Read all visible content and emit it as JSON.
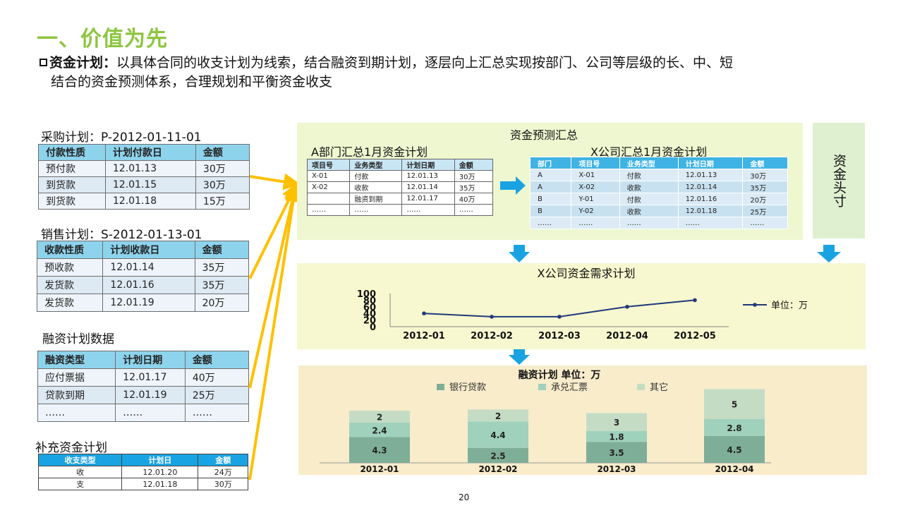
{
  "header": {
    "title": "一、价值为先",
    "bullet_lead": "资金计划：",
    "bullet_text1": "以具体合同的收支计划为线索，结合融资到期计划，逐层向上汇总实现按部门、公司等层级的长、中、短",
    "bullet_text2": "结合的资金预测体系，合理规划和平衡资金收支"
  },
  "purchase": {
    "label": "采购计划：P-2012-01-11-01",
    "headers": [
      "付款性质",
      "计划付款日",
      "金额"
    ],
    "rows": [
      [
        "预付款",
        "12.01.13",
        "30万"
      ],
      [
        "到货款",
        "12.01.15",
        "30万"
      ],
      [
        "到货款",
        "12.01.18",
        "15万"
      ]
    ]
  },
  "sales": {
    "label": "销售计划：S-2012-01-13-01",
    "headers": [
      "收款性质",
      "计划收款日",
      "金额"
    ],
    "rows": [
      [
        "预收款",
        "12.01.14",
        "35万"
      ],
      [
        "发货款",
        "12.01.16",
        "35万"
      ],
      [
        "发货款",
        "12.01.19",
        "20万"
      ]
    ]
  },
  "financing": {
    "label": "融资计划数据",
    "headers": [
      "融资类型",
      "计划日期",
      "金额"
    ],
    "rows": [
      [
        "应付票据",
        "12.01.17",
        "40万"
      ],
      [
        "贷款到期",
        "12.01.19",
        "25万"
      ],
      [
        "……",
        "……",
        "……"
      ]
    ]
  },
  "supplement": {
    "label": "补充资金计划",
    "headers": [
      "收支类型",
      "计划日",
      "金额"
    ],
    "rows": [
      [
        "收",
        "12.01.20",
        "24万"
      ],
      [
        "支",
        "12.01.18",
        "30万"
      ]
    ]
  },
  "forecast": {
    "title": "资金预测汇总",
    "dept_title": "A部门汇总1月资金计划",
    "dept_headers": [
      "项目号",
      "业务类型",
      "计划日期",
      "金额"
    ],
    "dept_rows": [
      [
        "X-01",
        "付款",
        "12.01.13",
        "30万"
      ],
      [
        "X-02",
        "收款",
        "12.01.14",
        "35万"
      ],
      [
        "",
        "融资到期",
        "12.01.17",
        "40万"
      ],
      [
        "……",
        "……",
        "……",
        "……"
      ]
    ],
    "co_title": "X公司汇总1月资金计划",
    "co_headers": [
      "部门",
      "项目号",
      "业务类型",
      "计划日期",
      "金额"
    ],
    "co_rows": [
      [
        "A",
        "X-01",
        "付款",
        "12.01.13",
        "30万"
      ],
      [
        "A",
        "X-02",
        "收款",
        "12.01.14",
        "35万"
      ],
      [
        "B",
        "Y-01",
        "付款",
        "12.01.16",
        "20万"
      ],
      [
        "B",
        "Y-02",
        "收款",
        "12.01.18",
        "25万"
      ],
      [
        "……",
        "……",
        "……",
        "……",
        "……"
      ]
    ]
  },
  "side_panel": {
    "text": "资金头寸"
  },
  "colors": {
    "title_green": "#8dc63f",
    "arrow_yellow": "#ffc000",
    "arrow_blue": "#1aa3e2",
    "line_navy": "#1f3a7a",
    "bank_loan": "#7fae98",
    "acceptance": "#9fd1bd",
    "other": "#c5dcc4"
  },
  "page_number": "20",
  "chart_data": [
    {
      "type": "line",
      "title": "X公司资金需求计划",
      "x": [
        "2012-01",
        "2012-02",
        "2012-03",
        "2012-04",
        "2012-05"
      ],
      "series": [
        {
          "name": "单位：万",
          "values": [
            40,
            30,
            30,
            60,
            80
          ]
        }
      ],
      "ylim": [
        0,
        100
      ],
      "yticks": [
        0,
        20,
        40,
        60,
        80,
        100
      ],
      "xlabel": "",
      "ylabel": "",
      "grid": false,
      "legend": "right"
    },
    {
      "type": "bar",
      "stacked": true,
      "title": "融资计划  单位：万",
      "categories": [
        "2012-01",
        "2012-02",
        "2012-03",
        "2012-04"
      ],
      "series": [
        {
          "name": "银行贷款",
          "values": [
            4.3,
            2.5,
            3.5,
            4.5
          ]
        },
        {
          "name": "承兑汇票",
          "values": [
            2.4,
            4.4,
            1.8,
            2.8
          ]
        },
        {
          "name": "其它",
          "values": [
            2,
            2,
            3,
            5
          ]
        }
      ],
      "legend": "top"
    }
  ]
}
